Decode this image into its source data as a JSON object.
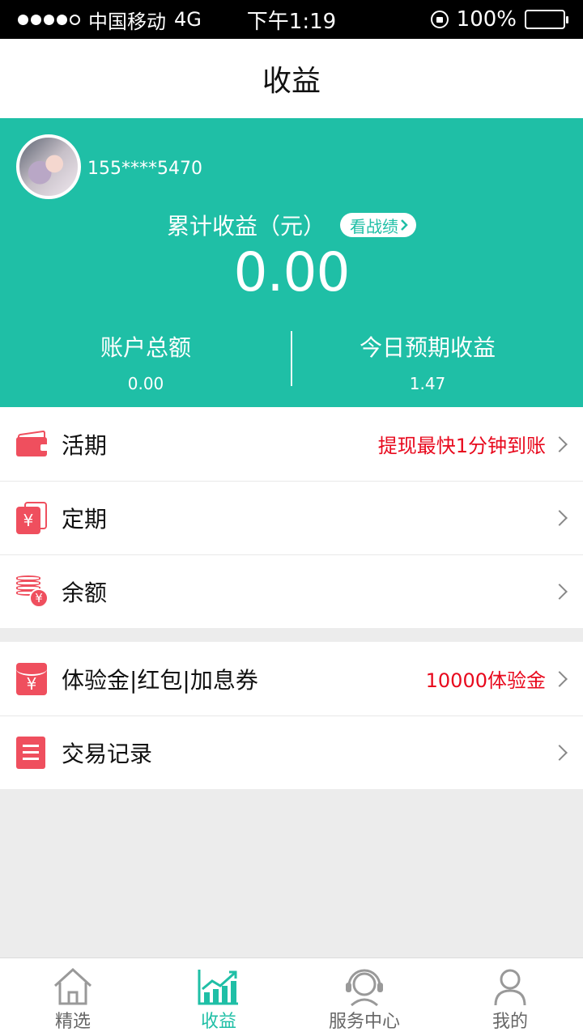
{
  "status_bar": {
    "carrier": "中国移动",
    "network": "4G",
    "time": "下午1:19",
    "battery": "100%"
  },
  "header": {
    "title": "收益"
  },
  "account": {
    "phone": "155****5470",
    "cumulative_label": "累计收益（元）",
    "record_button": "看战绩",
    "cumulative_value": "0.00",
    "total_label": "账户总额",
    "total_value": "0.00",
    "today_label": "今日预期收益",
    "today_value": "1.47"
  },
  "menu_group1": [
    {
      "label": "活期",
      "note": "提现最快1分钟到账",
      "icon": "wallet-icon"
    },
    {
      "label": "定期",
      "note": "",
      "icon": "cards-icon"
    },
    {
      "label": "余额",
      "note": "",
      "icon": "coins-icon"
    }
  ],
  "menu_group2": [
    {
      "label": "体验金|红包|加息券",
      "note": "10000体验金",
      "icon": "red-envelope-icon"
    },
    {
      "label": "交易记录",
      "note": "",
      "icon": "receipt-icon"
    }
  ],
  "tabs": [
    {
      "label": "精选",
      "icon": "home-icon",
      "active": false
    },
    {
      "label": "收益",
      "icon": "chart-icon",
      "active": true
    },
    {
      "label": "服务中心",
      "icon": "headset-icon",
      "active": false
    },
    {
      "label": "我的",
      "icon": "user-icon",
      "active": false
    }
  ],
  "colors": {
    "accent": "#1fbfa6",
    "icon_red": "#ef4f5e",
    "note_red": "#e8091d"
  }
}
